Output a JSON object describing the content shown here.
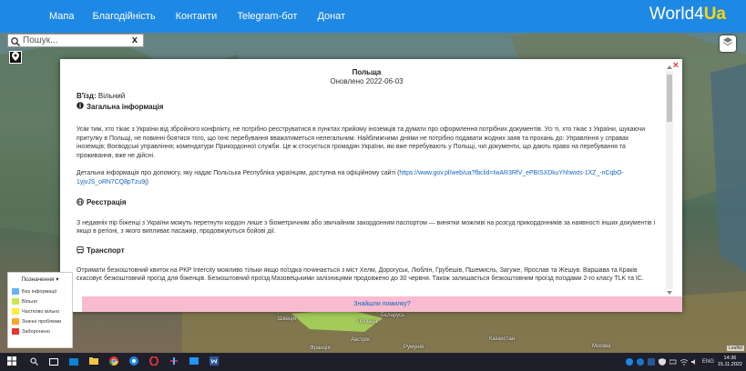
{
  "nav": {
    "items": [
      "Мапа",
      "Благодійність",
      "Контакти",
      "Telegram-бот",
      "Донат"
    ],
    "logo_main": "World4",
    "logo_accent": "Ua"
  },
  "search": {
    "placeholder": "Пошук...",
    "clear": "x"
  },
  "modal": {
    "country": "Польща",
    "updated": "Оновлено 2022-06-03",
    "entry_label": "В'їзд:",
    "entry_value": "Вільний",
    "close": "×",
    "sections": {
      "general_title": "Загальна інформація",
      "general_p1": "Усім тим, хто тікає з України від збройного конфлікту, не потрібно реєструватися в пунктах прийому іноземців та думати про оформлення потрібних документів. Усі ті, хто тікає з України, шукаючи притулку в Польщі, не повинні боятися того, що їхнє перебування вважатиметься нелегальним. Найближчими днями не потрібно подавати жодних заяв та прохань до: Управління у справах іноземців; Воєводські управління; комендатури Прикордонної служби. Це ж стосується громадян України, які вже перебувають у Польщі, чиї документи, що дають право на перебування та проживання, вже не дійсні.",
      "general_p2": "Детальна інформація про допомогу, яку надає Польська Республіка українцям, доступна на офіційному сайті (",
      "general_link": "https://www.gov.pl/web/ua?fbclid=IwAR3RfV_ePBISXDkuYhhwxts-1XZ_-nCqbO-1yjvJS_oRN7CQ8pTzu9j",
      "general_p2_end": ")",
      "registry_title": "Реєстрація",
      "registry_p": "З недавніх пір біженці з України можуть перетнути кордон лише з біометричним або звичайним закордонним паспортом — винятки можливі на розсуд прикордонників за наявності інших документів і якщо в регіоні, з якого випливає пасажир, продовжуються бойові дії.",
      "transport_title": "Транспорт",
      "transport_p": "Отримати безкоштовний квиток на PKP Intercity можливо тільки якщо поїздка починається з міст Хелм, Дорогуськ, Люблін, Грубешів, Пшемисль, Загуже, Ярослав та Жешув. Варшава та Краків скасовує безкоштовний проїзд для біженців. Безкоштовний проїзд Мазовецькими залізницями продовжено до 30 червня. Також залишається безкоштовним проїзд поїздами 2-го класу TLK та IC.",
      "ellipsis": "..."
    },
    "report": "Знайшли помилку?"
  },
  "legend": {
    "title": "Позначення ▾",
    "items": [
      {
        "label": "Без інформації",
        "color": "#64b5f6"
      },
      {
        "label": "Вільно",
        "color": "#c6e84a"
      },
      {
        "label": "Частково вільно",
        "color": "#ffeb3b"
      },
      {
        "label": "Значні проблеми",
        "color": "#ffa726"
      },
      {
        "label": "Заборонено",
        "color": "#e53935"
      }
    ]
  },
  "map_labels": [
    "Швеція",
    "Польща",
    "Бєларусь",
    "Австрія",
    "Румунія",
    "Франція",
    "Москва",
    "Казахстан"
  ],
  "attribution": "Leaflet",
  "taskbar": {
    "lang": "ENG",
    "time": "14:36",
    "date": "15.11.2022"
  },
  "colors": {
    "nav_bg": "#1e88e5",
    "logo_accent": "#ffd60a",
    "report_bg": "#f8bbd0"
  }
}
